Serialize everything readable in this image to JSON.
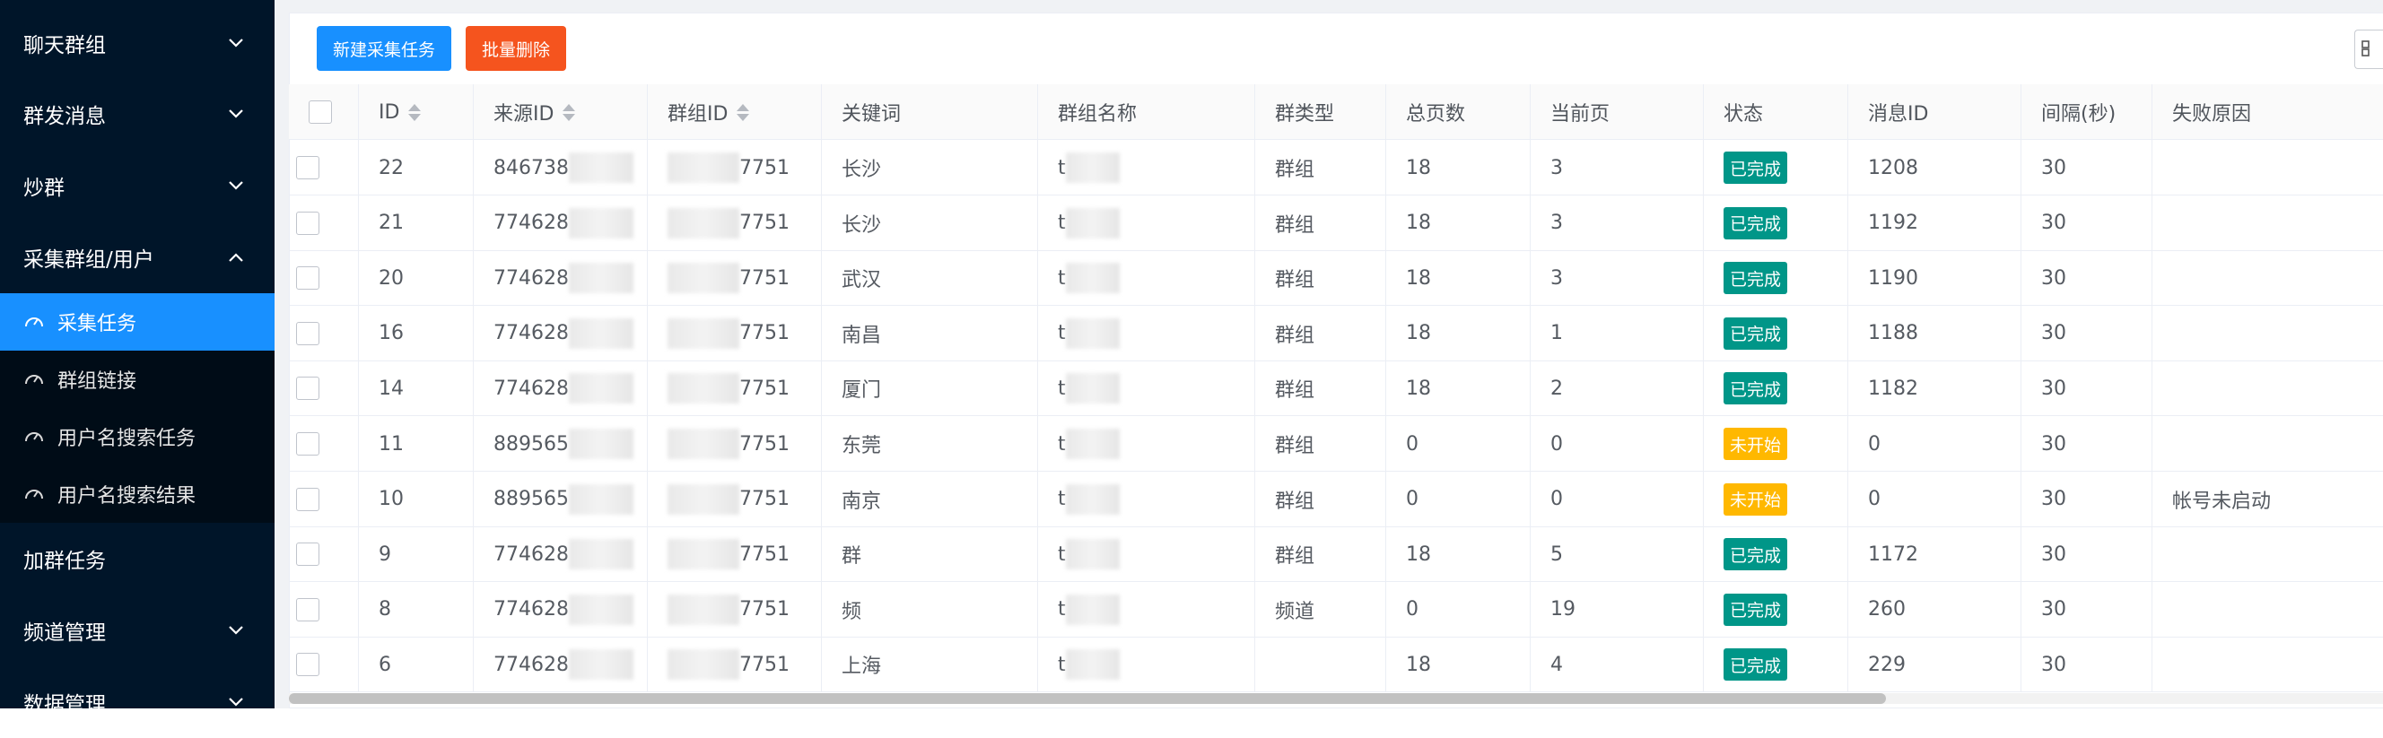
{
  "sidebar": {
    "menus": [
      {
        "label": "聊天群组",
        "expanded": false
      },
      {
        "label": "群发消息",
        "expanded": false
      },
      {
        "label": "炒群",
        "expanded": false
      },
      {
        "label": "采集群组/用户",
        "expanded": true
      },
      {
        "label": "加群任务",
        "expanded": false
      },
      {
        "label": "频道管理",
        "expanded": false
      },
      {
        "label": "数据管理",
        "expanded": false
      }
    ],
    "submenu": [
      {
        "label": "采集任务",
        "active": true
      },
      {
        "label": "群组链接",
        "active": false
      },
      {
        "label": "用户名搜索任务",
        "active": false
      },
      {
        "label": "用户名搜索结果",
        "active": false
      }
    ]
  },
  "toolbar": {
    "new_task_label": "新建采集任务",
    "batch_delete_label": "批量删除"
  },
  "table": {
    "columns": [
      "ID",
      "来源ID",
      "群组ID",
      "关键词",
      "群组名称",
      "群类型",
      "总页数",
      "当前页",
      "状态",
      "消息ID",
      "间隔(秒)",
      "失败原因"
    ],
    "rows": [
      {
        "id": "22",
        "source_id": "846738",
        "group_id": "7751",
        "keyword": "长沙",
        "group_name": "t",
        "type": "群组",
        "total": "18",
        "current": "3",
        "status": "已完成",
        "msg_id": "1208",
        "interval": "30",
        "reason": ""
      },
      {
        "id": "21",
        "source_id": "774628",
        "group_id": "7751",
        "keyword": "长沙",
        "group_name": "t",
        "type": "群组",
        "total": "18",
        "current": "3",
        "status": "已完成",
        "msg_id": "1192",
        "interval": "30",
        "reason": ""
      },
      {
        "id": "20",
        "source_id": "774628",
        "group_id": "7751",
        "keyword": "武汉",
        "group_name": "t",
        "type": "群组",
        "total": "18",
        "current": "3",
        "status": "已完成",
        "msg_id": "1190",
        "interval": "30",
        "reason": ""
      },
      {
        "id": "16",
        "source_id": "774628",
        "group_id": "7751",
        "keyword": "南昌",
        "group_name": "t",
        "type": "群组",
        "total": "18",
        "current": "1",
        "status": "已完成",
        "msg_id": "1188",
        "interval": "30",
        "reason": ""
      },
      {
        "id": "14",
        "source_id": "774628",
        "group_id": "7751",
        "keyword": "厦门",
        "group_name": "t",
        "type": "群组",
        "total": "18",
        "current": "2",
        "status": "已完成",
        "msg_id": "1182",
        "interval": "30",
        "reason": ""
      },
      {
        "id": "11",
        "source_id": "889565",
        "group_id": "7751",
        "keyword": "东莞",
        "group_name": "t",
        "type": "群组",
        "total": "0",
        "current": "0",
        "status": "未开始",
        "msg_id": "0",
        "interval": "30",
        "reason": ""
      },
      {
        "id": "10",
        "source_id": "889565",
        "group_id": "7751",
        "keyword": "南京",
        "group_name": "t",
        "type": "群组",
        "total": "0",
        "current": "0",
        "status": "未开始",
        "msg_id": "0",
        "interval": "30",
        "reason": "帐号未启动"
      },
      {
        "id": "9",
        "source_id": "774628",
        "group_id": "7751",
        "keyword": "群",
        "group_name": "t",
        "type": "群组",
        "total": "18",
        "current": "5",
        "status": "已完成",
        "msg_id": "1172",
        "interval": "30",
        "reason": ""
      },
      {
        "id": "8",
        "source_id": "774628",
        "group_id": "7751",
        "keyword": "频",
        "group_name": "t",
        "type": "频道",
        "total": "0",
        "current": "19",
        "status": "已完成",
        "msg_id": "260",
        "interval": "30",
        "reason": ""
      },
      {
        "id": "6",
        "source_id": "774628",
        "group_id": "7751",
        "keyword": "上海",
        "group_name": "t",
        "type": "",
        "total": "18",
        "current": "4",
        "status": "已完成",
        "msg_id": "229",
        "interval": "30",
        "reason": ""
      }
    ]
  },
  "colors": {
    "sidebar_bg": "#001529",
    "active_item": "#1890ff",
    "primary_button": "#1890ff",
    "danger_button": "#f5541e",
    "status_done": "#009688",
    "status_pending": "#ffb800"
  }
}
